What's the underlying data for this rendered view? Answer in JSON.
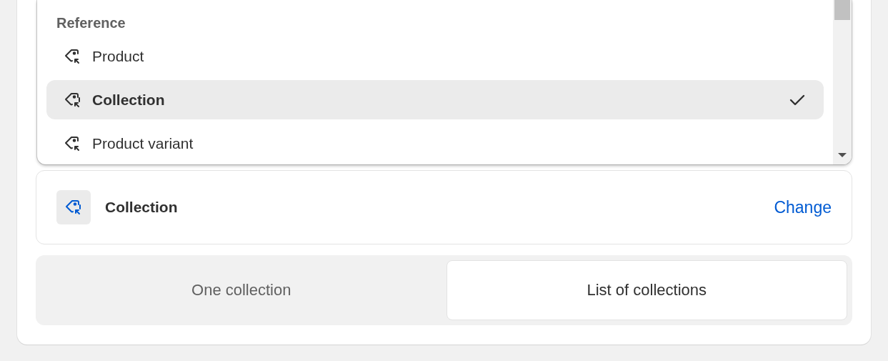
{
  "dropdown": {
    "section_title": "Reference",
    "options": [
      {
        "label": "Product",
        "selected": false
      },
      {
        "label": "Collection",
        "selected": true
      },
      {
        "label": "Product variant",
        "selected": false
      }
    ]
  },
  "selected_type": {
    "label": "Collection",
    "action": "Change"
  },
  "toggle": [
    {
      "label": "One collection",
      "selected": false
    },
    {
      "label": "List of collections",
      "selected": true
    }
  ]
}
